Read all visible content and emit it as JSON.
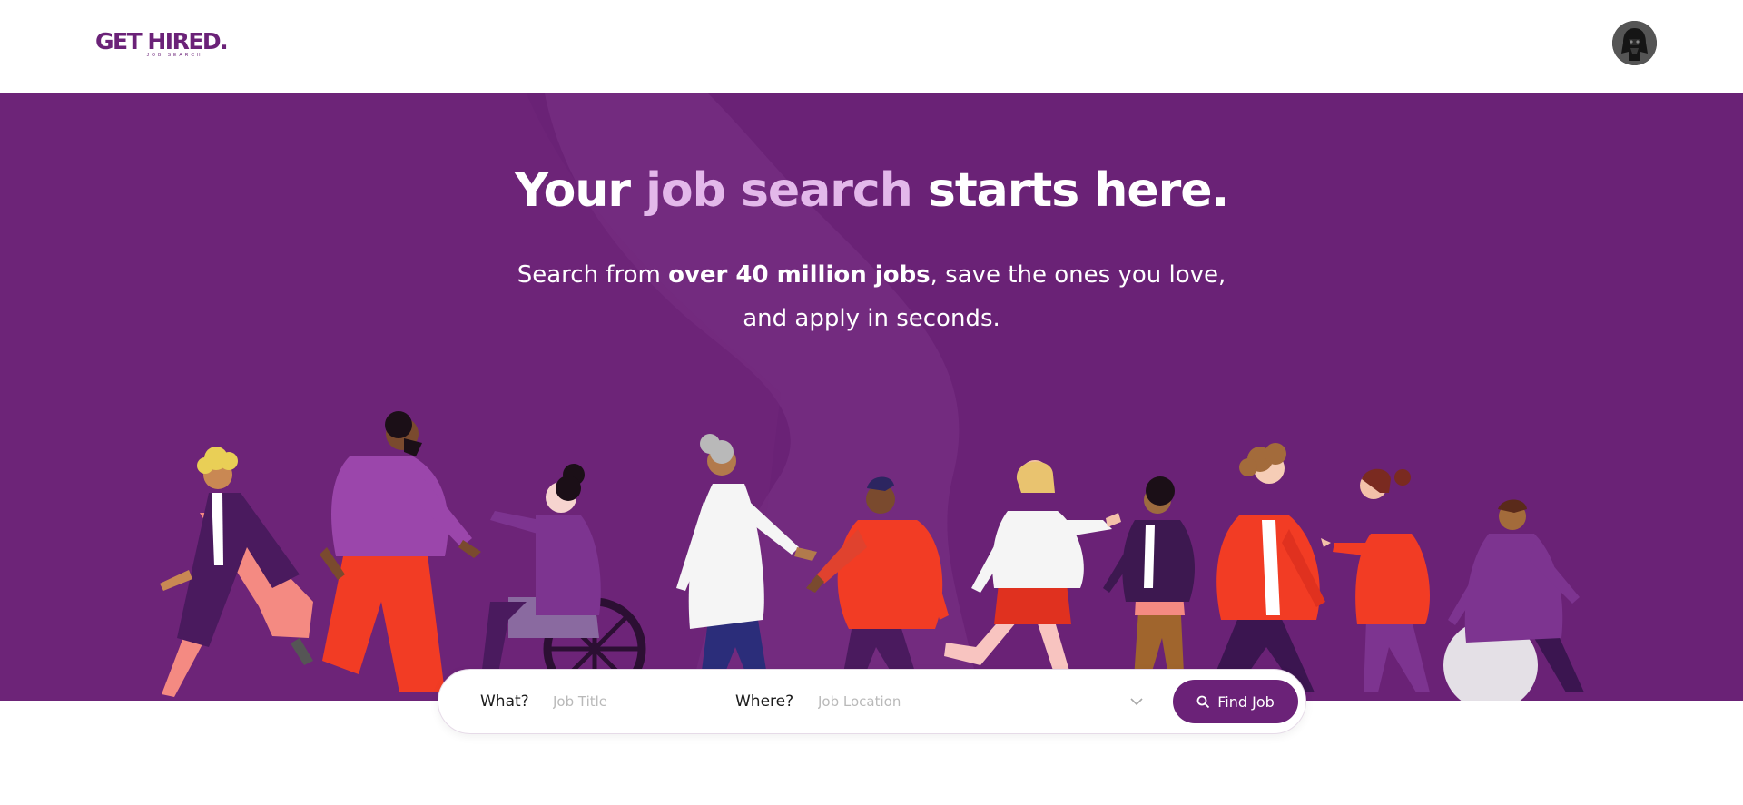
{
  "header": {
    "logo_text": "GET HIRED.",
    "logo_tagline": "JOB SEARCH",
    "avatar_icon": "user-avatar-icon"
  },
  "hero": {
    "headline_part1": "Your ",
    "headline_highlight": "job search",
    "headline_part2": " starts here.",
    "subtext_part1": "Search from ",
    "subtext_bold": "over 40 million jobs",
    "subtext_part2": ", save the ones you love,",
    "subtext_line2": "and apply in seconds.",
    "illustration": "diverse-people-walking-illustration"
  },
  "search": {
    "what_label": "What?",
    "what_placeholder": "Job Title",
    "where_label": "Where?",
    "where_placeholder": "Job Location",
    "dropdown_icon": "chevron-down-icon",
    "button_label": "Find Job",
    "button_icon": "search-icon"
  },
  "colors": {
    "brand_purple": "#6b2278",
    "hero_background": "#6a2276",
    "headline_highlight": "#e3b8ea",
    "accent_red": "#f23c24"
  }
}
